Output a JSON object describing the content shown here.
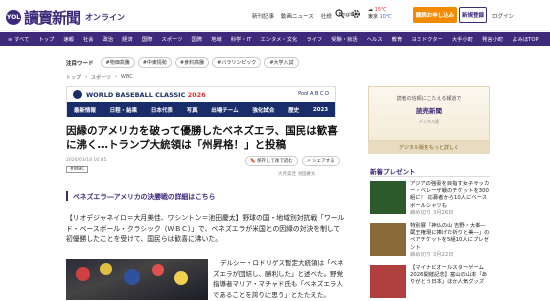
{
  "header": {
    "logo_mark": "YOL",
    "logo_name": "讀賣新聞",
    "logo_sub": "オンライン",
    "top_links": [
      "新刊記事",
      "動画ニュース",
      "社説",
      "English"
    ],
    "weather": {
      "temp_hi": "15℃",
      "temp_lo": "10℃",
      "label": "東京"
    },
    "subscribe_label": "購読お申し込み",
    "register_label": "新規登録",
    "login_label": "ログイン"
  },
  "nav": [
    "≡ すべて",
    "トップ",
    "速報",
    "社会",
    "政治",
    "経済",
    "国際",
    "スポーツ",
    "国際",
    "地域",
    "科学・IT",
    "エンタメ・文化",
    "ライフ",
    "受験・就活",
    "ヘルス",
    "教育",
    "ヨミドクター",
    "大手小町",
    "発言小町",
    "よみほTOP"
  ],
  "attention": {
    "label": "注目ワード",
    "tags": [
      "#物価高騰",
      "#中東情勢",
      "#食料高騰",
      "#パラリンピック",
      "#大学入試"
    ]
  },
  "breadcrumb": [
    "トップ",
    "スポーツ",
    "WBC"
  ],
  "wbc_banner": {
    "title_prefix": "WORLD BASEBALL CLASSIC",
    "title_year": "2026",
    "pool": "Pool  A  B  C  D",
    "tabs": [
      "最新情報",
      "日程・結果",
      "日本代表",
      "写真",
      "出場チーム",
      "強化試合",
      "歴史",
      "2023"
    ]
  },
  "article": {
    "headline": "因縁のアメリカを破って優勝したベネズエラ、国民は歓喜に沸く…トランプ大統領は「州昇格！」と投稿",
    "date": "2026/03/18 16:45",
    "actions": [
      "保存して後で読む",
      "シェアする"
    ],
    "tag": "#WBC",
    "authors": "大月美佳  池田慶太",
    "related_link": "ベネズエラ―アメリカの決勝戦の詳細はこちら",
    "lead": "【リオデジャネイロ＝大月美佳、ワシントン＝池田慶太】野球の国・地域別対抗戦「ワールド・ベースボール・クラシック（ＷＢＣ）」で、ベネズエラが米国との因縁の対決を制して初優勝したことを受けて、国民らは歓喜に沸いた。",
    "caption": "デルシー・ロドリゲス暫定大統領は「ベネズエラが団結し、勝利した」と述べた。野党指導者マリア・マチャド氏も「ベネズエラ人であることを誇りに思う」とたたえた。"
  },
  "sidebar": {
    "ad1_line1": "読者の信頼にこたえる報道で",
    "ad1_line2": "読売新聞",
    "ad1_line3": "デジタル版",
    "ad2_label": "デジタル版をもっと詳しく",
    "present_title": "新着プレゼント",
    "present_items": [
      {
        "text": "アジアの強豪を目指す女子サッカー・ベレーザ戦のチケットを300組に！ 応募者から10人にベースボールシャツも",
        "deadline": "締め切り 3月26日",
        "color": "#2c5a2a"
      },
      {
        "text": "特別展「神仏の山 吉野・大峯―蔵王権現に捧げた祈りと美―」のペアチケットを5組10人にプレゼント",
        "deadline": "締め切り 3月22日",
        "color": "#8a6a3a"
      },
      {
        "text": "【マイナビオールスターゲーム2026開催記念】富山の山本「ありがとう日本」ほか人気グッズ",
        "deadline": "",
        "color": "#b04040"
      }
    ]
  }
}
